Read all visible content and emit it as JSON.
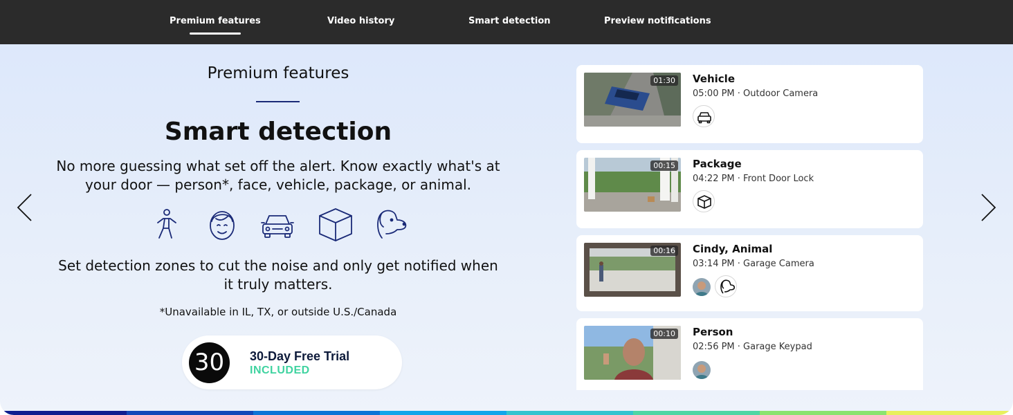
{
  "nav": {
    "items": [
      {
        "label": "Premium features",
        "active": true
      },
      {
        "label": "Video history",
        "active": false
      },
      {
        "label": "Smart detection",
        "active": false
      },
      {
        "label": "Preview notifications",
        "active": false
      }
    ]
  },
  "hero": {
    "eyebrow": "Premium features",
    "headline": "Smart detection",
    "description": "No more guessing what set off the alert. Know exactly what's at your door — person*, face, vehicle, package, or animal.",
    "detection_icons": [
      "person-icon",
      "face-icon",
      "vehicle-icon",
      "package-icon",
      "animal-icon"
    ],
    "description2": "Set detection zones to cut the noise and only get notified when it truly matters.",
    "footnote": "*Unavailable in IL, TX, or outside U.S./Canada",
    "trial": {
      "badge": "30",
      "title": "30-Day Free Trial",
      "subtitle": "INCLUDED"
    }
  },
  "events": [
    {
      "duration": "01:30",
      "title": "Vehicle",
      "meta": "05:00 PM · Outdoor Camera",
      "tags": [
        "car-icon"
      ]
    },
    {
      "duration": "00:15",
      "title": "Package",
      "meta": "04:22 PM · Front Door Lock",
      "tags": [
        "package-icon"
      ]
    },
    {
      "duration": "00:16",
      "title": "Cindy, Animal",
      "meta": "03:14 PM · Garage Camera",
      "tags": [
        "face-avatar",
        "dog-icon"
      ]
    },
    {
      "duration": "00:10",
      "title": "Person",
      "meta": "02:56 PM · Garage Keypad",
      "tags": [
        "face-avatar"
      ]
    }
  ],
  "colors": {
    "nav_bg": "#2b2b2b",
    "accent_rule": "#1a2a77",
    "trial_included": "#3fd3a0",
    "stripe": [
      "#0f1f8f",
      "#1249b8",
      "#0e74d6",
      "#12a6ea",
      "#34c4cf",
      "#4fd6a4",
      "#8be36f",
      "#e8f05e"
    ]
  }
}
